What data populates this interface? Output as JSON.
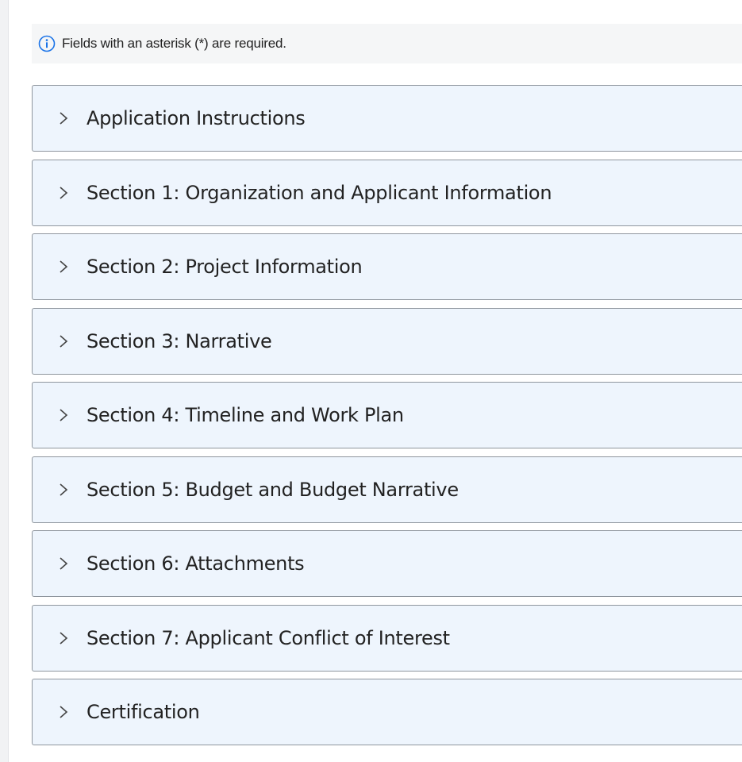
{
  "notice": {
    "icon": "info-circle-icon",
    "text": "Fields with an asterisk (*) are required."
  },
  "colors": {
    "accent": "#1a73e8",
    "section_bg": "#eef5fd",
    "section_border": "#8f969e"
  },
  "sections": [
    {
      "label": "Application Instructions",
      "icon": "chevron-right-icon"
    },
    {
      "label": "Section 1: Organization and Applicant Information",
      "icon": "chevron-right-icon"
    },
    {
      "label": "Section 2: Project Information",
      "icon": "chevron-right-icon"
    },
    {
      "label": "Section 3: Narrative",
      "icon": "chevron-right-icon"
    },
    {
      "label": "Section 4: Timeline and Work Plan",
      "icon": "chevron-right-icon"
    },
    {
      "label": "Section 5: Budget and Budget Narrative",
      "icon": "chevron-right-icon"
    },
    {
      "label": "Section 6: Attachments",
      "icon": "chevron-right-icon"
    },
    {
      "label": "Section 7: Applicant Conflict of Interest",
      "icon": "chevron-right-icon"
    },
    {
      "label": "Certification",
      "icon": "chevron-right-icon"
    }
  ]
}
